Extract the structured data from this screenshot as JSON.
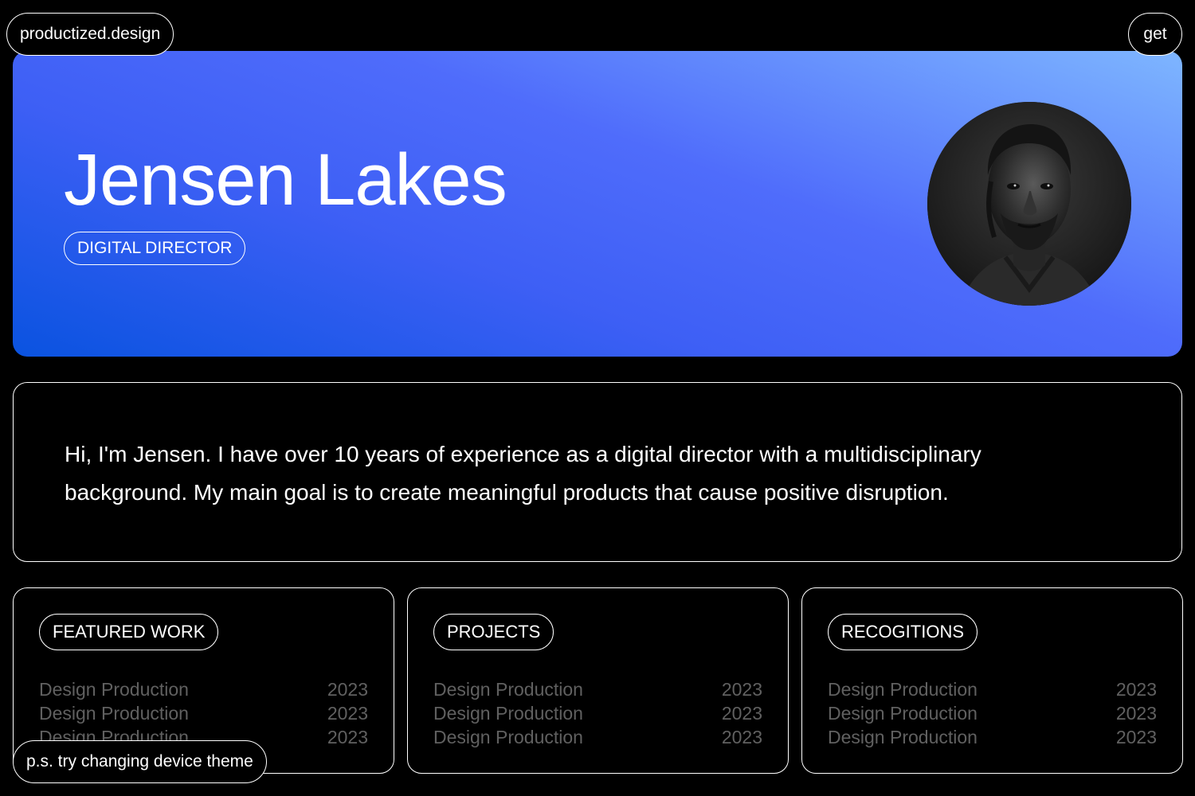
{
  "header": {
    "brand": "productized.design",
    "get_label": "get"
  },
  "hero": {
    "name": "Jensen Lakes",
    "role": "DIGITAL DIRECTOR",
    "colors": {
      "gradient_start": "#0a53e0",
      "gradient_mid": "#4f6cfb",
      "gradient_end": "#7eb6ff"
    }
  },
  "bio": {
    "text": "Hi, I'm Jensen. I have over 10 years of experience as a digital director with a multidisciplinary background. My main goal is to create meaningful products that cause positive disruption."
  },
  "cards": [
    {
      "title": "FEATURED WORK",
      "rows": [
        {
          "label": "Design Production",
          "year": "2023"
        },
        {
          "label": "Design Production",
          "year": "2023"
        },
        {
          "label": "Design Production",
          "year": "2023"
        }
      ]
    },
    {
      "title": "PROJECTS",
      "rows": [
        {
          "label": "Design Production",
          "year": "2023"
        },
        {
          "label": "Design Production",
          "year": "2023"
        },
        {
          "label": "Design Production",
          "year": "2023"
        }
      ]
    },
    {
      "title": "RECOGITIONS",
      "rows": [
        {
          "label": "Design Production",
          "year": "2023"
        },
        {
          "label": "Design Production",
          "year": "2023"
        },
        {
          "label": "Design Production",
          "year": "2023"
        }
      ]
    }
  ],
  "footer": {
    "note": "p.s. try changing device theme"
  }
}
